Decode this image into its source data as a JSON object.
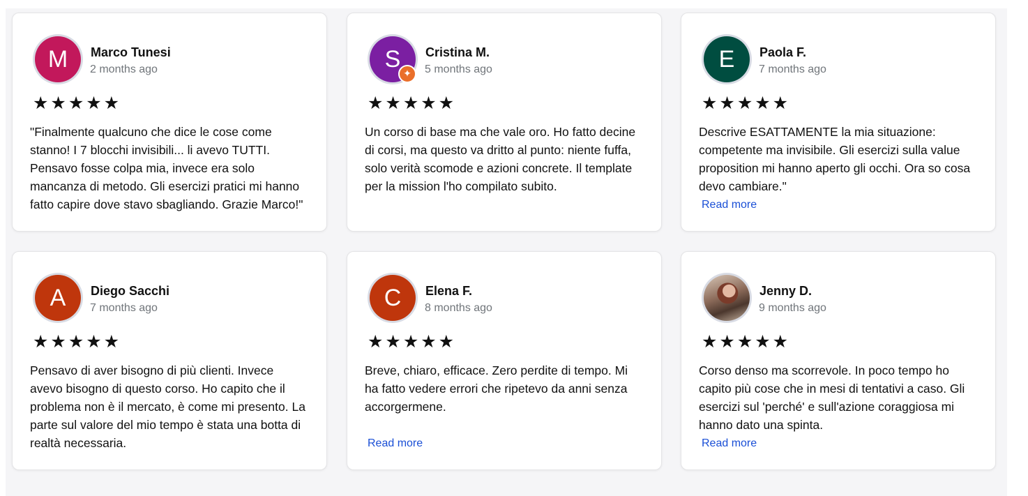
{
  "reviews": [
    {
      "initial": "M",
      "avatar_color": "#c2185b",
      "name": "Marco Tunesi",
      "time": "2 months ago",
      "stars": "★★★★★",
      "text": "\"Finalmente qualcuno che dice le cose come stanno! I 7 blocchi invisibili... li avevo TUTTI. Pensavo fosse colpa mia, invece era solo mancanza di metodo. Gli esercizi pratici mi hanno fatto capire dove stavo sbagliando. Grazie Marco!\""
    },
    {
      "initial": "S",
      "avatar_color": "#7b1fa2",
      "badge_icon": "star-badge-icon",
      "name": "Cristina M.",
      "time": "5 months ago",
      "stars": "★★★★★",
      "text": "Un corso di base ma che vale oro. Ho fatto decine di corsi, ma questo va dritto al punto: niente fuffa, solo verità scomode e azioni concrete. Il template per la mission l'ho compilato subito."
    },
    {
      "initial": "E",
      "avatar_color": "#004d40",
      "name": "Paola F.",
      "time": "7 months ago",
      "stars": "★★★★★",
      "text": "Descrive ESATTAMENTE la mia situazione: competente ma invisibile. Gli esercizi sulla value proposition mi hanno aperto gli occhi. Ora so cosa devo cambiare.\"",
      "read_more": "Read more"
    },
    {
      "initial": "A",
      "avatar_color": "#bf360c",
      "name": "Diego Sacchi",
      "time": "7 months ago",
      "stars": "★★★★★",
      "text": "Pensavo di aver bisogno di più clienti. Invece avevo bisogno di questo corso. Ho capito che il problema non è il mercato, è come mi presento. La parte sul valore del mio tempo è stata una botta di realtà necessaria."
    },
    {
      "initial": "C",
      "avatar_color": "#bf360c",
      "name": "Elena F.",
      "time": "8 months ago",
      "stars": "★★★★★",
      "text": "Breve, chiaro, efficace. Zero perdite di tempo. Mi ha fatto vedere errori che ripetevo da anni senza accorgermene.",
      "read_more": "Read more"
    },
    {
      "avatar_icon": "profile-photo",
      "name": "Jenny D.",
      "time": "9 months ago",
      "stars": "★★★★★",
      "text": "Corso denso ma scorrevole. In poco tempo ho capito più cose che in mesi di tentativi a caso. Gli esercizi sul 'perché' e sull'azione coraggiosa mi hanno dato una spinta.",
      "read_more": "Read more"
    }
  ]
}
